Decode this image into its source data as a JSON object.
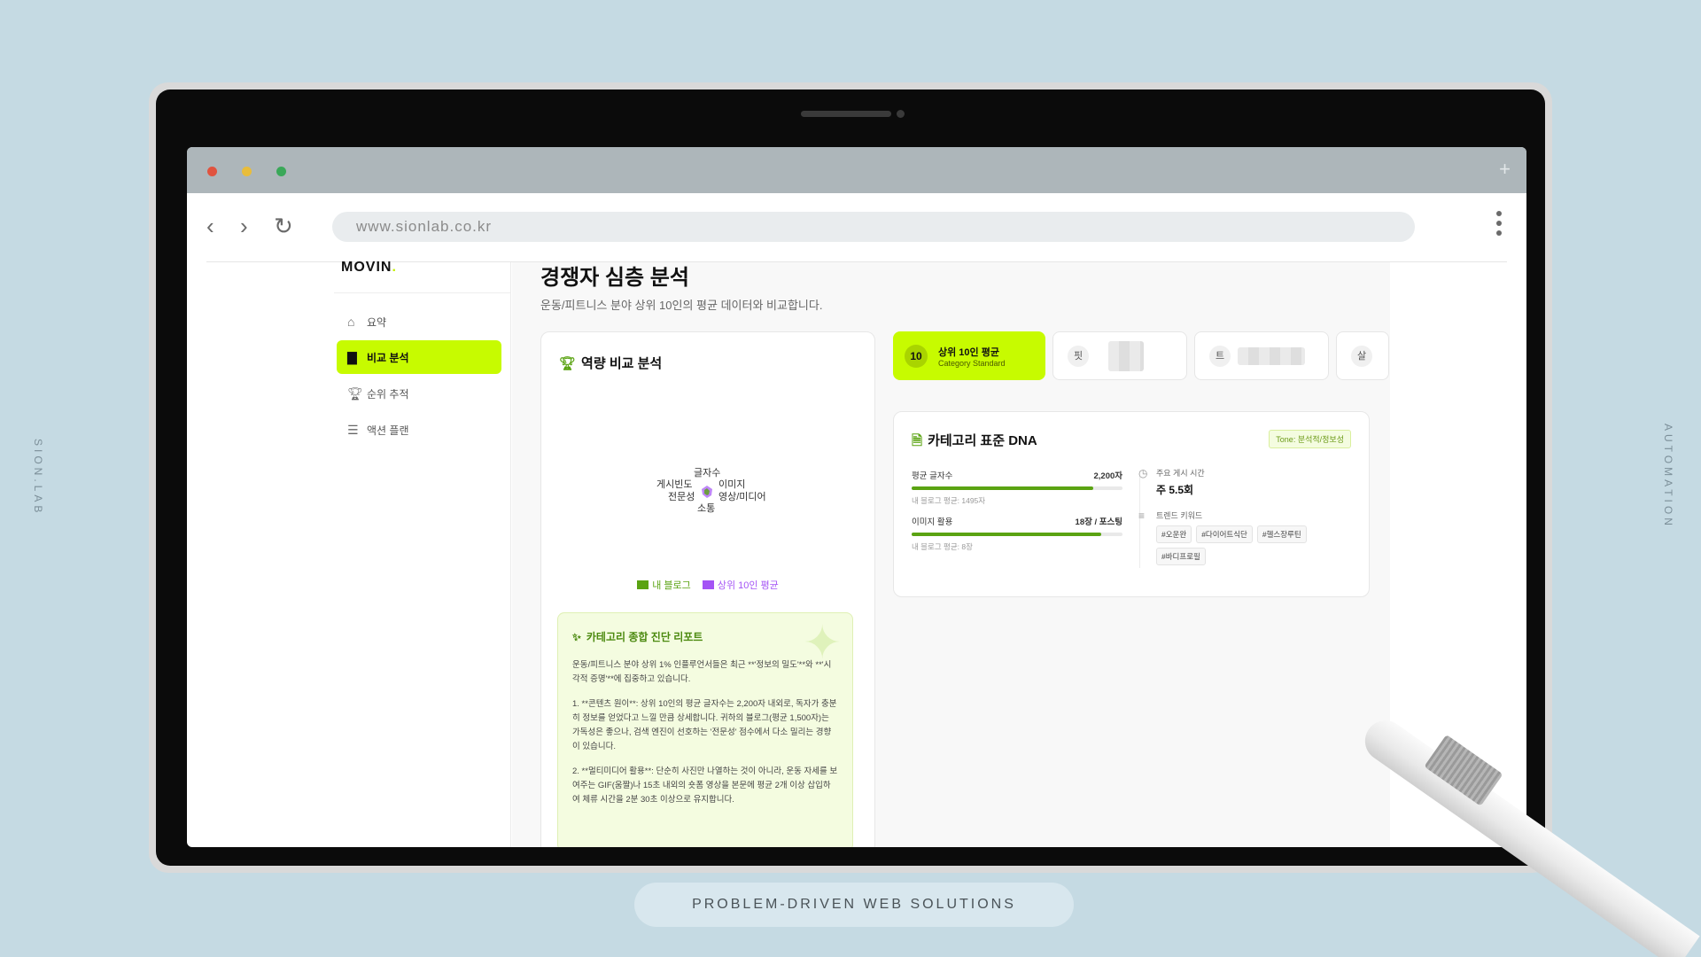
{
  "side_left": "SION.LAB",
  "side_right": "AUTOMATION",
  "browser": {
    "url": "www.sionlab.co.kr",
    "plus": "+"
  },
  "sidebar": {
    "brand": "MOVIN",
    "brand_dot": ".",
    "items": [
      {
        "label": "요약",
        "icon": "home-icon"
      },
      {
        "label": "비교 분석",
        "icon": "bar-chart-icon",
        "active": true
      },
      {
        "label": "순위 추적",
        "icon": "trophy-icon"
      },
      {
        "label": "액션 플랜",
        "icon": "checklist-icon"
      }
    ]
  },
  "page": {
    "title": "경쟁자 심층 분석",
    "subtitle": "운동/피트니스 분야 상위 10인의 평균 데이터와 비교합니다."
  },
  "radar": {
    "title": "역량 비교 분석",
    "labels": {
      "top": "글자수",
      "right_top": "이미지",
      "right_bottom": "영상/미디어",
      "bottom": "소통",
      "left_bottom": "전문성",
      "left_top": "게시빈도"
    },
    "legend": {
      "mine": "내 블로그",
      "top10": "상위 10인 평균"
    },
    "colors": {
      "mine": "#5aa312",
      "top10": "#a454f5"
    }
  },
  "report": {
    "title": "카테고리 종합 진단 리포트",
    "paragraphs": [
      "운동/피트니스 분야 상위 1% 인플루언서들은 최근 **'정보의 밀도'**와 **'시각적 증명'**에 집중하고 있습니다.",
      "1. **콘텐츠 원이**: 상위 10인의 평균 글자수는 2,200자 내외로, 독자가 충분히 정보를 얻었다고 느낄 만큼 상세합니다. 귀하의 블로그(평균 1,500자)는 가독성은 좋으나, 검색 엔진이 선호하는 '전문성' 점수에서 다소 밀리는 경향이 있습니다.",
      "2. **멀티미디어 활용**: 단순히 사진만 나열하는 것이 아니라, 운동 자세를 보여주는 GIF(움짤)나 15초 내외의 숏폼 영상을 본문에 평균 2개 이상 삽입하여 체류 시간을 2분 30초 이상으로 유지합니다."
    ]
  },
  "tabs": [
    {
      "num": "10",
      "label": "상위 10인 평균",
      "sub": "Category Standard",
      "active": true
    },
    {
      "initial": "핏"
    },
    {
      "initial": "트"
    },
    {
      "initial": "살"
    }
  ],
  "dna": {
    "title": "카테고리 표준 DNA",
    "tone": "Tone: 분석적/정보성",
    "metrics": [
      {
        "label": "평균 글자수",
        "value": "2,200자",
        "note": "내 블로그 평균: 1495자",
        "fill_percent": 86
      },
      {
        "label": "이미지 활용",
        "value": "18장 / 포스팅",
        "note": "내 블로그 평균: 8장",
        "fill_percent": 90
      }
    ],
    "post_freq": {
      "label": "주요 게시 시간",
      "value": "주 5.5회"
    },
    "keywords": {
      "label": "트렌드 키워드",
      "tags": [
        "#오운완",
        "#다이어트식단",
        "#헬스장루틴",
        "#바디프로필"
      ]
    }
  },
  "footer": "PROBLEM-DRIVEN WEB SOLUTIONS"
}
